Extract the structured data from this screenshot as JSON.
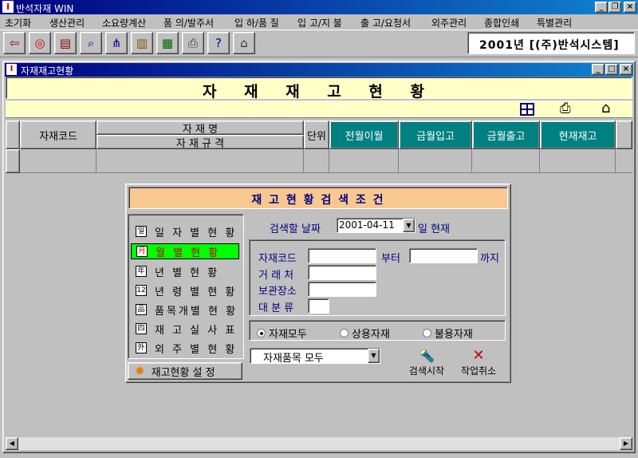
{
  "app": {
    "title": "반석자재 WIN"
  },
  "menu": [
    "초기화",
    "생산관리",
    "소요량계산",
    "품 의/발주서",
    "입 하/품 질",
    "입 고/지 불",
    "출 고/요청서",
    "외주관리",
    "종합인쇄",
    "특별관리"
  ],
  "company_label": "2001년 [(주)반석시스템]",
  "toolbar": {
    "icons": [
      "exit-icon",
      "lifebuoy-icon",
      "book-icon",
      "search-doc-icon",
      "network-icon",
      "ledger-icon",
      "calculator-icon",
      "printer-icon",
      "help-icon",
      "home-icon"
    ]
  },
  "child_window": {
    "title": "자재재고현황"
  },
  "form": {
    "title": "자 재 재 고 현 황"
  },
  "grid": {
    "col_code": "자재코드",
    "col_name": "자 재 명",
    "col_spec": "자 재 규 격",
    "col_unit": "단위",
    "col_prev": "전월이월",
    "col_in": "금월입고",
    "col_out": "금월출고",
    "col_stock": "현재재고"
  },
  "search": {
    "title": "재 고 현 황   검 색 조 건",
    "side_items": [
      {
        "label": "일 자 별 현 황",
        "icon": "일"
      },
      {
        "label": "월   별 현 황",
        "icon": "月"
      },
      {
        "label": "년   별 현 황",
        "icon": "年"
      },
      {
        "label": "년 령 별 현 황",
        "icon": "12"
      },
      {
        "label": "품목개별 현 황",
        "icon": "品"
      },
      {
        "label": "재 고 실 사 표",
        "icon": "四"
      },
      {
        "label": "외 주 별 현 황",
        "icon": "外"
      }
    ],
    "settings_button": "재고현황 설 정",
    "date_label": "검색할 날짜",
    "date_value": "2001-04-11",
    "date_suffix": "일 현재",
    "code_label": "자재코드",
    "from_label": "부터",
    "to_label": "까지",
    "vendor_label": "거 래 처",
    "storage_label": "보관장소",
    "category_label": "대 분 류",
    "radio_all": "자재모두",
    "radio_used": "상용자재",
    "radio_unused": "불용자재",
    "item_select": "자재품목 모두",
    "search_button": "검색시작",
    "cancel_button": "작업취소"
  }
}
